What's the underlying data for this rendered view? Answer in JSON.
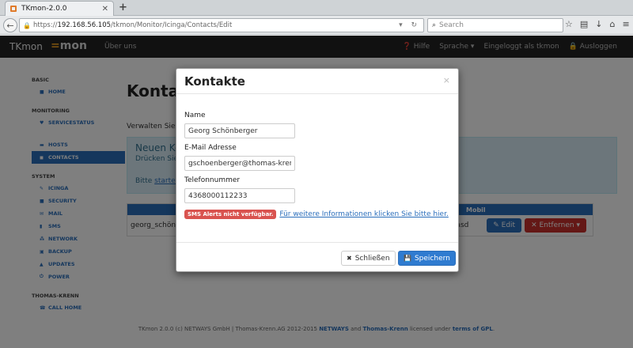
{
  "browser": {
    "tab_title": "TKmon-2.0.0",
    "url_prefix": "https://",
    "url_host": "192.168.56.105",
    "url_path": "/tkmon/Monitor/Icinga/Contacts/Edit",
    "search_placeholder": "Search"
  },
  "app": {
    "brand": "TKmon",
    "logo_a": "=",
    "logo_b": "mon",
    "nav_link": "Über uns",
    "help": "Hilfe",
    "language": "Sprache",
    "logged_in": "Eingeloggt als tkmon",
    "logout": "Ausloggen"
  },
  "sidebar": {
    "sections": [
      {
        "title": "BASIC",
        "items": [
          {
            "label": "HOME",
            "icon": "home-icon"
          }
        ]
      },
      {
        "title": "MONITORING",
        "items": [
          {
            "label": "SERVICESTATUS",
            "icon": "heart-icon"
          },
          {
            "label": "HOSTS",
            "icon": "hosts-icon"
          },
          {
            "label": "CONTACTS",
            "icon": "contacts-icon",
            "active": true
          }
        ]
      },
      {
        "title": "SYSTEM",
        "items": [
          {
            "label": "ICINGA",
            "icon": "wrench-icon"
          },
          {
            "label": "SECURITY",
            "icon": "lock-icon"
          },
          {
            "label": "MAIL",
            "icon": "mail-icon"
          },
          {
            "label": "SMS",
            "icon": "phone-icon"
          },
          {
            "label": "NETWORK",
            "icon": "network-icon"
          },
          {
            "label": "BACKUP",
            "icon": "backup-icon"
          },
          {
            "label": "UPDATES",
            "icon": "updates-icon"
          },
          {
            "label": "POWER",
            "icon": "power-icon"
          }
        ]
      },
      {
        "title": "THOMAS-KRENN",
        "items": [
          {
            "label": "CALL HOME",
            "icon": "call-icon"
          }
        ]
      }
    ]
  },
  "main": {
    "title": "Kontakte",
    "desc": "Verwalten Sie hier",
    "well_title": "Neuen Ko",
    "well_text": "Drücken Sie a",
    "well_hint_pre": "Bitte ",
    "well_hint_link": "starten",
    "col_name": "Name",
    "col_mobil": "Mobil",
    "row_name": "georg_schönb",
    "row_mobil": "adasd",
    "edit_label": "Edit",
    "remove_label": "Entfernen"
  },
  "footer": {
    "text_a": "TKmon 2.0.0 (c) NETWAYS GmbH | Thomas-Krenn.AG 2012-2015 ",
    "netways": "NETWAYS",
    "and": " and ",
    "tk": "Thomas-Krenn",
    "licensed": " licensed under ",
    "gpl": "terms of GPL"
  },
  "modal": {
    "title": "Kontakte",
    "name_label": "Name",
    "name_value": "Georg Schönberger",
    "email_label": "E-Mail Adresse",
    "email_value": "gschoenberger@thomas-krenn.com",
    "phone_label": "Telefonnummer",
    "phone_value": "4368000112233",
    "sms_badge": "SMS Alerts nicht verfügbar.",
    "sms_link": "Für weitere Informationen klicken Sie bitte hier.",
    "close_label": "Schließen",
    "save_label": "Speichern"
  }
}
